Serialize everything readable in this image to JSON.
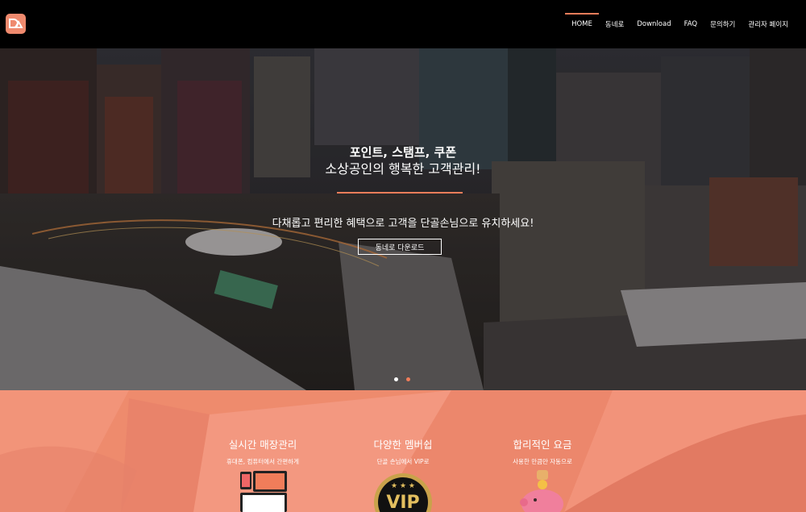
{
  "navbar": {
    "logo_text": "D",
    "items": [
      {
        "label": "HOME",
        "active": true
      },
      {
        "label": "동네로",
        "active": false
      },
      {
        "label": "Download",
        "active": false
      },
      {
        "label": "FAQ",
        "active": false
      },
      {
        "label": "문의하기",
        "active": false
      },
      {
        "label": "관리자 페이지",
        "active": false
      }
    ]
  },
  "hero": {
    "title_line1": "포인트, 스탬프, 쿠폰",
    "title_line2": "소상공인의 행복한 고객관리!",
    "subtitle": "다채롭고 편리한 혜택으로 고객을 단골손님으로 유치하세요!",
    "button_label": "동네로 다운로드",
    "slides_total": 2,
    "active_slide": 2
  },
  "features": [
    {
      "title": "실시간 매장관리",
      "desc": "휴대폰, 컴퓨터에서 간편하게",
      "icon": "devices-icon"
    },
    {
      "title": "다양한 멤버쉽",
      "desc": "단골 손님에서 VIP로",
      "icon": "vip-badge-icon"
    },
    {
      "title": "합리적인 요금",
      "desc": "사용한 만큼만 자동으로",
      "icon": "piggy-bank-icon"
    }
  ],
  "colors": {
    "accent": "#f07d5a",
    "feature_bg": "#ee8b6d",
    "navbar_bg": "#000000"
  }
}
